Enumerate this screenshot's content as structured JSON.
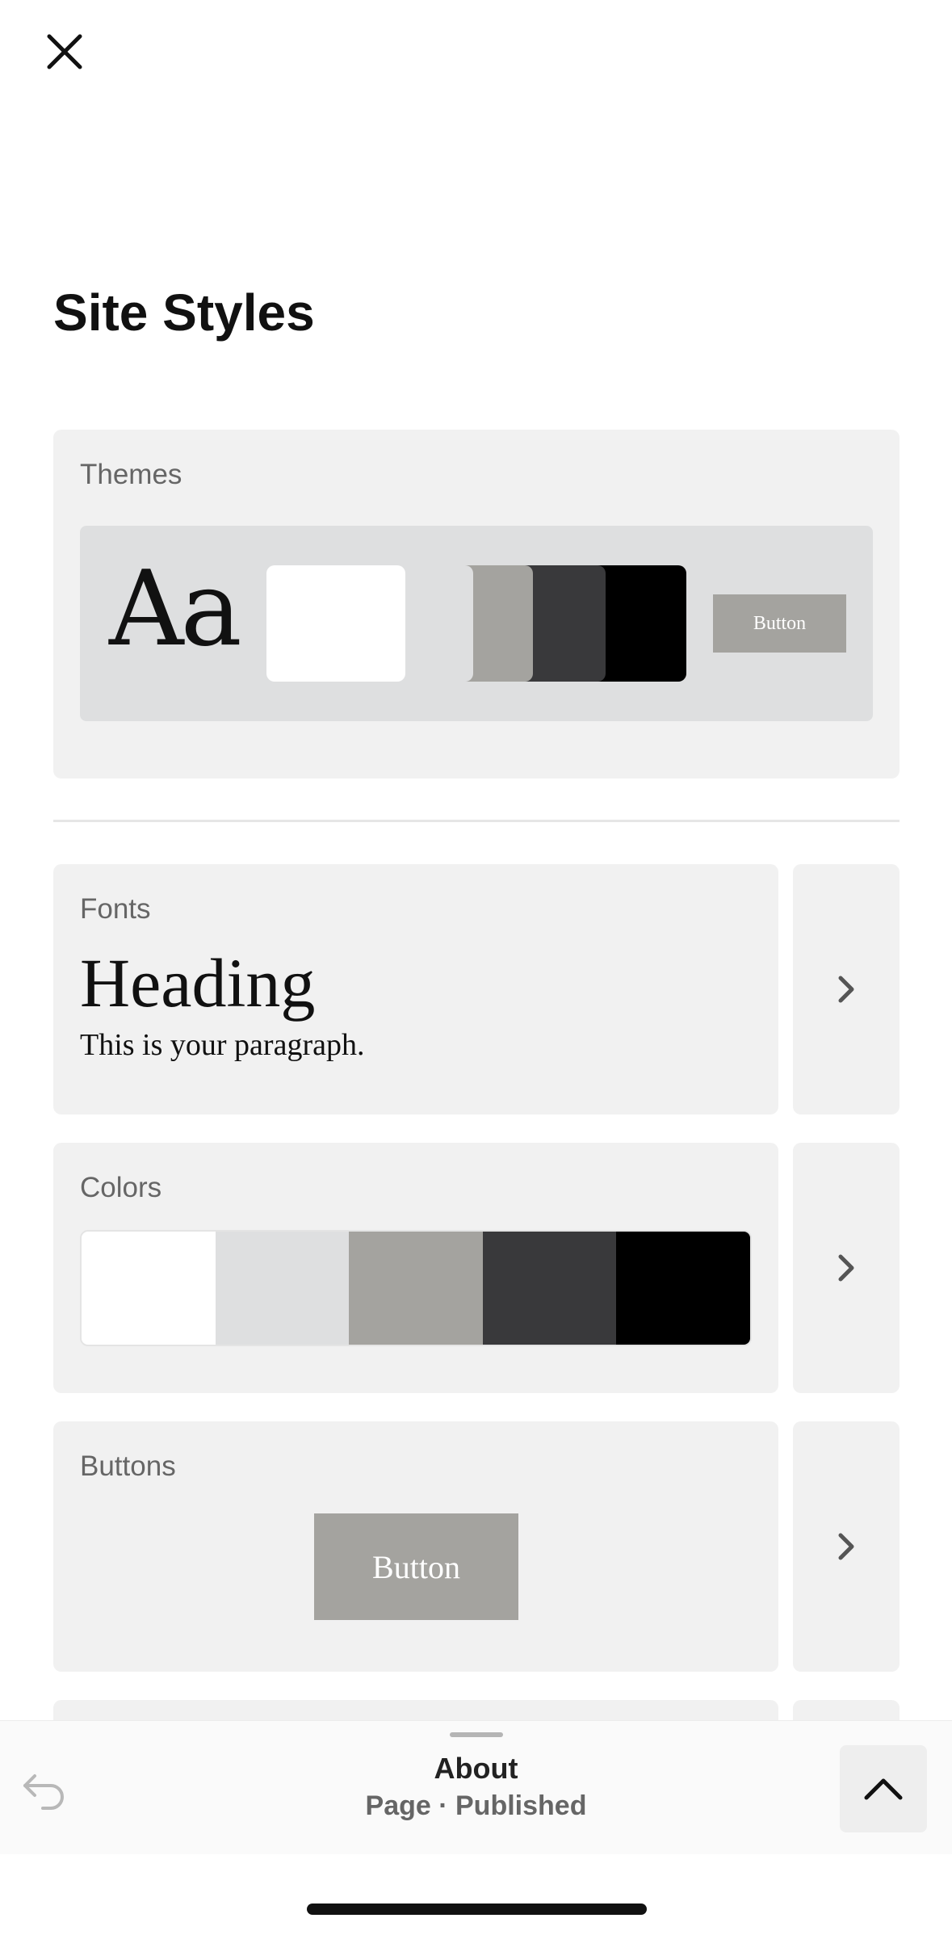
{
  "header": {
    "close_icon": "close-icon",
    "title": "Site Styles"
  },
  "themes": {
    "label": "Themes",
    "font_sample": "Aa",
    "swatches": [
      "#ffffff",
      "#dedfe0",
      "#a4a39f",
      "#39393b",
      "#000000"
    ],
    "button_label": "Button"
  },
  "fonts": {
    "label": "Fonts",
    "heading_sample": "Heading",
    "paragraph_sample": "This is your paragraph.",
    "arrow_icon": "chevron-right-icon"
  },
  "colors": {
    "label": "Colors",
    "swatches": [
      "#ffffff",
      "#dedfe0",
      "#a4a39f",
      "#39393b",
      "#000000"
    ],
    "arrow_icon": "chevron-right-icon"
  },
  "buttons": {
    "label": "Buttons",
    "button_label": "Button",
    "arrow_icon": "chevron-right-icon"
  },
  "bottom_bar": {
    "undo_icon": "undo-icon",
    "page_name": "About",
    "page_status": "Page · Published",
    "expand_icon": "chevron-up-icon"
  }
}
